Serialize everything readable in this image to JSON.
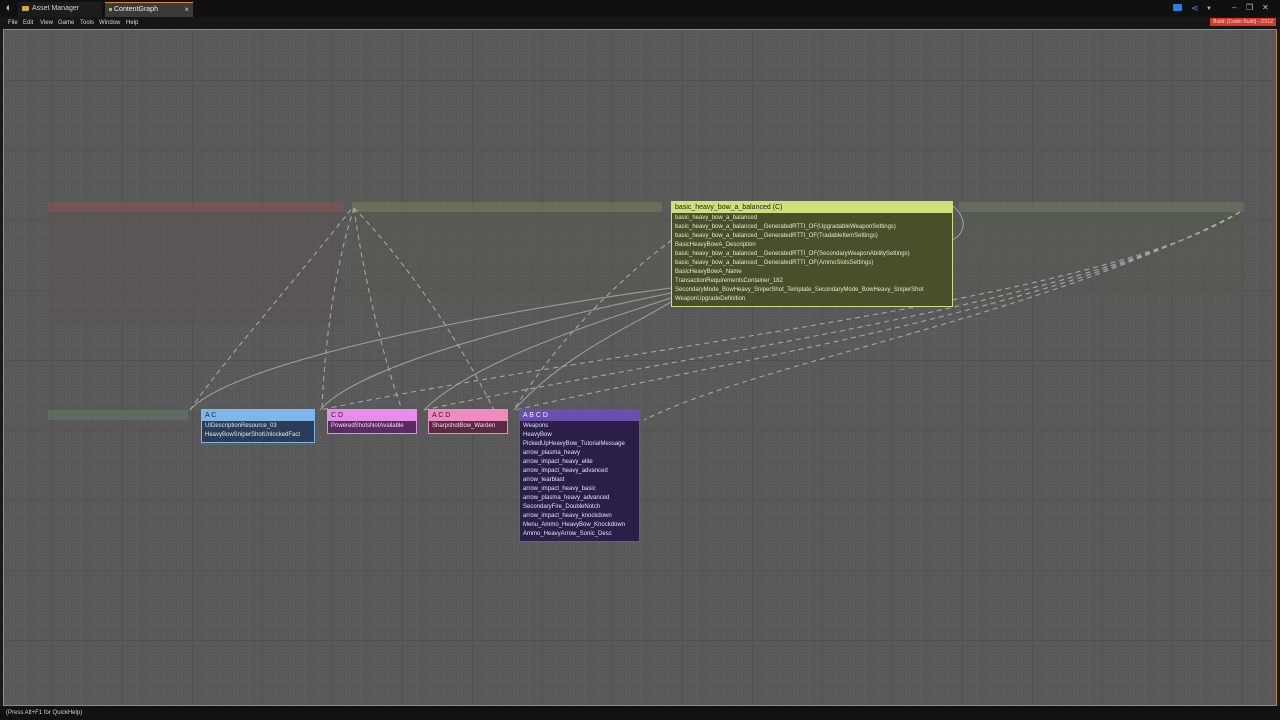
{
  "titlebar": {
    "tabs": [
      {
        "label": "Asset Manager",
        "active": false
      },
      {
        "label": "ContentGraph",
        "active": true
      }
    ],
    "close_glyph": "×"
  },
  "menubar": {
    "items": [
      "File",
      "Edit",
      "View",
      "Game",
      "Tools",
      "Window",
      "Help"
    ],
    "build_badge": "Build: [Coder Build] - DX12"
  },
  "graph": {
    "main_node": {
      "title": "basic_heavy_bow_a_balanced (C)",
      "items": [
        "basic_heavy_bow_a_balanced",
        "basic_heavy_bow_a_balanced__GeneratedRTTI_OF(UpgradableWeaponSettings)",
        "basic_heavy_bow_a_balanced__GeneratedRTTI_OF(TradableItemSettings)",
        "BasicHeavyBowA_Description",
        "basic_heavy_bow_a_balanced__GeneratedRTTI_OF(SecondaryWeaponAbilitySettings)",
        "basic_heavy_bow_a_balanced__GeneratedRTTI_OF(AmmoSlotsSettings)",
        "BasicHeavyBowA_Name",
        "TransactionRequirementsContainer_182",
        "SecondaryMode_BowHeavy_SniperShot_Template_SecondaryMode_BowHeavy_SniperShot",
        "WeaponUpgradeDefinition"
      ]
    },
    "nodes": [
      {
        "title": "A C",
        "items": [
          "UIDescriptionResource_03",
          "HeavyBowSniperShotUnlockedFact"
        ]
      },
      {
        "title": "C D",
        "items": [
          "PoweredShotsNotAvailable"
        ]
      },
      {
        "title": "A C D",
        "items": [
          "SharpshotBow_Warden"
        ]
      },
      {
        "title": "A B C D",
        "items": [
          "Weapons",
          "HeavyBow",
          "PickedUpHeavyBow_TutorialMessage",
          "arrow_plasma_heavy",
          "arrow_impact_heavy_elite",
          "arrow_impact_heavy_advanced",
          "arrow_tearblast",
          "arrow_impact_heavy_basic",
          "arrow_plasma_heavy_advanced",
          "SecondaryFire_DoubleNotch",
          "arrow_impact_heavy_knockdown",
          "Menu_Ammo_HeavyBow_Knockdown",
          "Ammo_HeavyArrow_Sonic_Desc"
        ]
      }
    ]
  },
  "statusbar": {
    "hint": "(Press Alt+F1 for QuickHelp)"
  },
  "colors": {
    "main_header": "#cfe07a",
    "main_body": "#47502a",
    "ac_header": "#7fb6ea",
    "ac_body": "#2b3c58",
    "cd_header": "#e58de8",
    "cd_body": "#5a2a63",
    "acd_header": "#ee8cc0",
    "acd_body": "#5a2a45",
    "abcd_header": "#6b4fae",
    "abcd_body": "#2a1f48",
    "frame_accent": "#b5892d"
  },
  "icons": [
    "app-logo-icon",
    "folder-icon",
    "chat-icon",
    "share-icon",
    "minimize-icon",
    "maximize-icon",
    "close-icon"
  ]
}
